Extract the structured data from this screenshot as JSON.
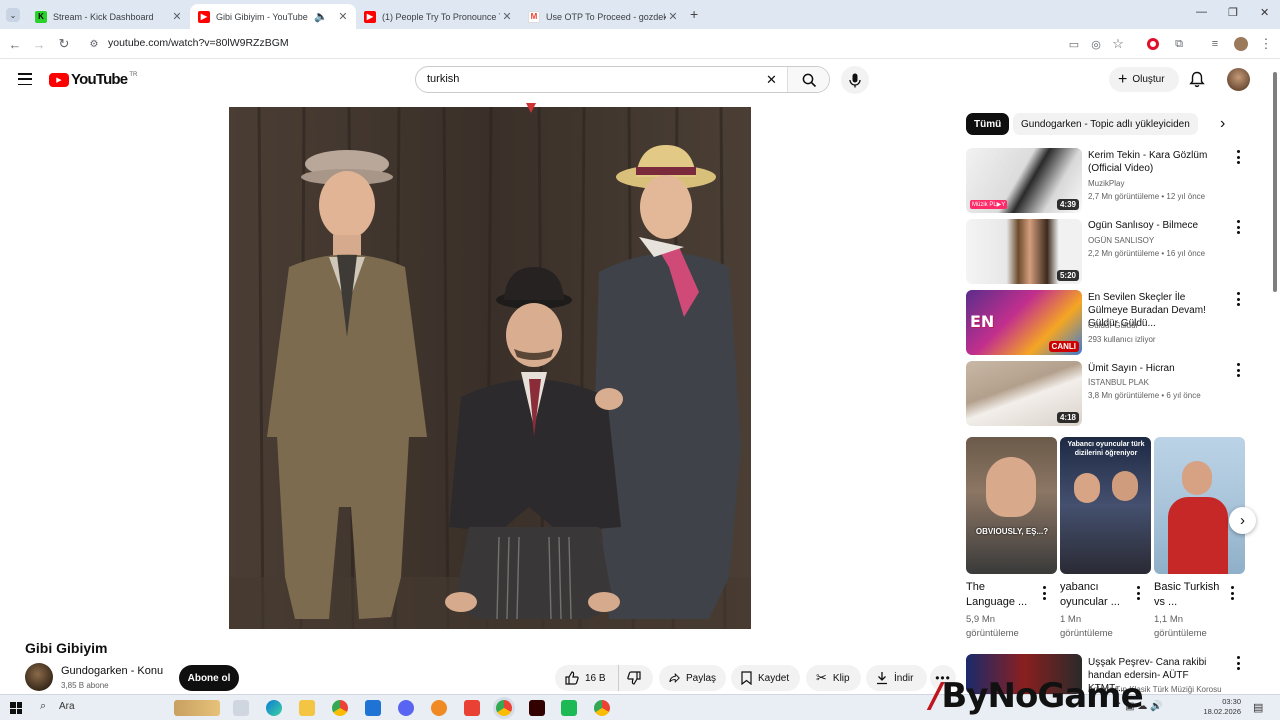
{
  "browser": {
    "tabs": [
      {
        "title": "Stream - Kick Dashboard",
        "active": false
      },
      {
        "title": "Gibi Gibiyim - YouTube",
        "active": true
      },
      {
        "title": "(1) People Try To Pronounce Th",
        "active": false
      },
      {
        "title": "Use OTP To Proceed - gozdek...",
        "active": false
      }
    ],
    "url": "youtube.com/watch?v=80lW9RZzBGM"
  },
  "youtube": {
    "logo_text": "YouTube",
    "region": "TR",
    "search_value": "turkish",
    "create_label": "Oluştur"
  },
  "video": {
    "title": "Gibi Gibiyim",
    "channel": "Gundogarken - Konu",
    "subscribers": "3,85 B abone",
    "subscribe_label": "Abone ol",
    "likes": "16 B",
    "share_label": "Paylaş",
    "save_label": "Kaydet",
    "clip_label": "Klip",
    "download_label": "İndir"
  },
  "sidebar": {
    "chips": [
      {
        "label": "Tümü",
        "active": true
      },
      {
        "label": "Gundogarken - Topic adlı yükleyiciden",
        "active": false
      }
    ],
    "recommendations": [
      {
        "title": "Kerim Tekin - Kara Gözlüm (Official Video)",
        "channel": "MuzikPlay",
        "meta": "2,7 Mn görüntüleme • 12 yıl önce",
        "duration": "4:39"
      },
      {
        "title": "Ogün Sanlısoy - Bilmece",
        "channel": "OGÜN SANLISOY",
        "meta": "2,2 Mn görüntüleme • 16 yıl önce",
        "duration": "5:20"
      },
      {
        "title": "En Sevilen Skeçler İle Gülmeye Buradan Devam! Güldür Güldü...",
        "channel": "Güldür Güldür",
        "meta": "293 kullanıcı izliyor",
        "duration": "CANLI"
      },
      {
        "title": "Ümit Sayın - Hicran",
        "channel": "İSTANBUL PLAK",
        "meta": "3,8 Mn görüntüleme • 6 yıl önce",
        "duration": "4:18"
      }
    ],
    "shorts": [
      {
        "title": "The Language ...",
        "views": "5,9 Mn",
        "views_label": "görüntüleme",
        "overlay": "OBVIOUSLY, EŞ...?"
      },
      {
        "title": "yabancı oyuncular ...",
        "views": "1 Mn",
        "views_label": "görüntüleme",
        "overlay": "Yabancı oyuncular türk dizilerini öğreniyor"
      },
      {
        "title": "Basic Turkish vs ...",
        "views": "1,1 Mn",
        "views_label": "görüntüleme",
        "overlay": ""
      }
    ],
    "bottom_item": {
      "title": "Uşşak Peşrev- Cana rakibi handan edersin- AÜTF KTMT-...",
      "channel": "Ankara Tıp Klasik Türk Müziği Korosu"
    }
  },
  "taskbar": {
    "search_label": "Ara",
    "time": "03:30",
    "date": "18.02.2026"
  },
  "watermark": "ByNoGame",
  "colors": {
    "youtube_red": "#ff0000",
    "accent": "#065fd4"
  }
}
